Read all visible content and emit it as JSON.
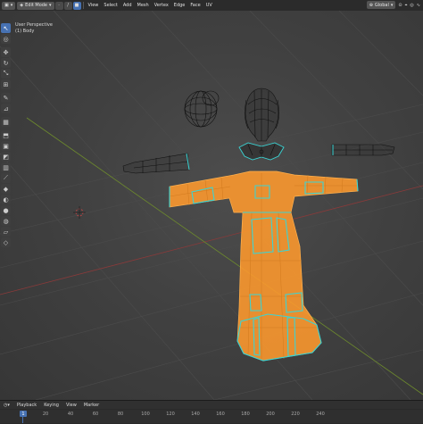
{
  "header": {
    "mode": "Edit Mode",
    "menus": [
      "View",
      "Select",
      "Add",
      "Mesh",
      "Vertex",
      "Edge",
      "Face",
      "UV"
    ],
    "transform_orientation": "Global"
  },
  "overlay": {
    "view_name": "User Perspective",
    "object_name": "(1) Body"
  },
  "timeline": {
    "menus": [
      "Playback",
      "Keying",
      "View",
      "Marker"
    ],
    "current_frame": "1",
    "ticks": [
      "20",
      "40",
      "60",
      "80",
      "100",
      "120",
      "140",
      "160",
      "180",
      "200",
      "220",
      "240"
    ]
  },
  "colors": {
    "selected_face": "#ff9a2e",
    "selected_edge": "#ffb04d",
    "seam_edge": "#3ad4d4",
    "wire": "#111111",
    "active_tool": "#4772b3"
  },
  "icons": [
    "cursor-icon",
    "3d-cursor-icon",
    "move-icon",
    "rotate-icon",
    "scale-icon",
    "transform-icon",
    "annotate-icon",
    "measure-icon",
    "add-cube-icon",
    "extrude-icon",
    "inset-icon",
    "bevel-icon",
    "loop-cut-icon",
    "knife-icon",
    "poly-build-icon",
    "spin-icon",
    "smooth-icon",
    "shrink-icon",
    "shear-icon",
    "rip-icon"
  ]
}
